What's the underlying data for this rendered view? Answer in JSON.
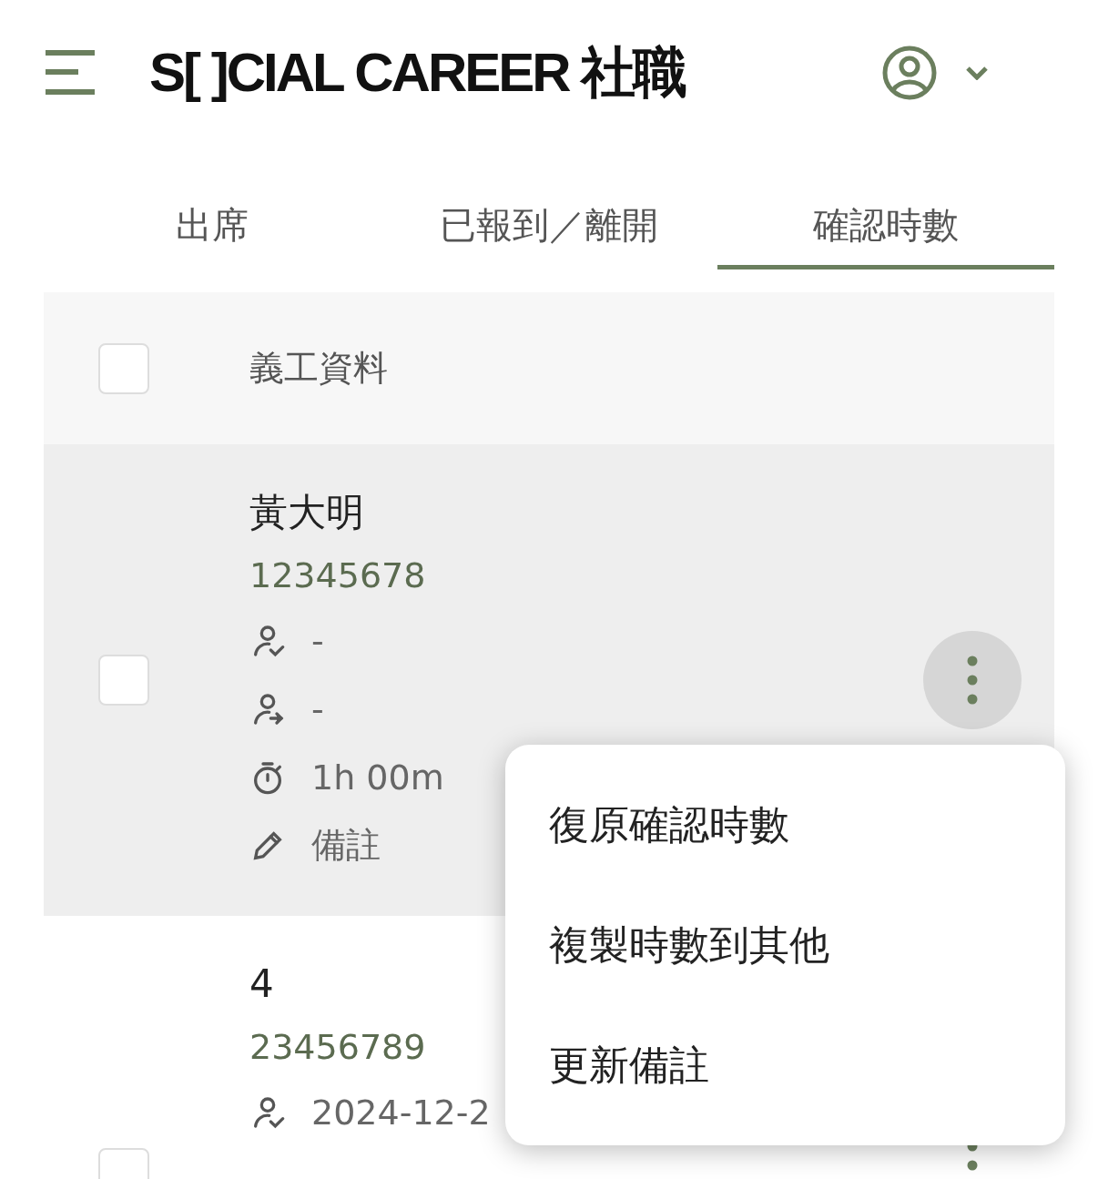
{
  "header": {
    "logo": "S[ ]CIAL CAREER 社職"
  },
  "tabs": [
    {
      "label": "出席",
      "selected": false
    },
    {
      "label": "已報到／離開",
      "selected": false
    },
    {
      "label": "確認時數",
      "selected": true
    }
  ],
  "table": {
    "header": {
      "checked": false,
      "label": "義工資料"
    },
    "rows": [
      {
        "name": "黃大明",
        "id": "12345678",
        "checked": false,
        "menu_open": true,
        "details": [
          {
            "kind": "check-in",
            "text": "-"
          },
          {
            "kind": "check-out",
            "text": "-"
          },
          {
            "kind": "duration",
            "text": "1h 00m"
          },
          {
            "kind": "note",
            "text": "備註"
          }
        ]
      },
      {
        "name": "4",
        "id": "23456789",
        "checked": false,
        "menu_open": false,
        "details": [
          {
            "kind": "check-in",
            "text": "2024-12-2"
          }
        ]
      }
    ]
  },
  "menu": {
    "items": [
      "復原確認時數",
      "複製時數到其他",
      "更新備註"
    ]
  }
}
